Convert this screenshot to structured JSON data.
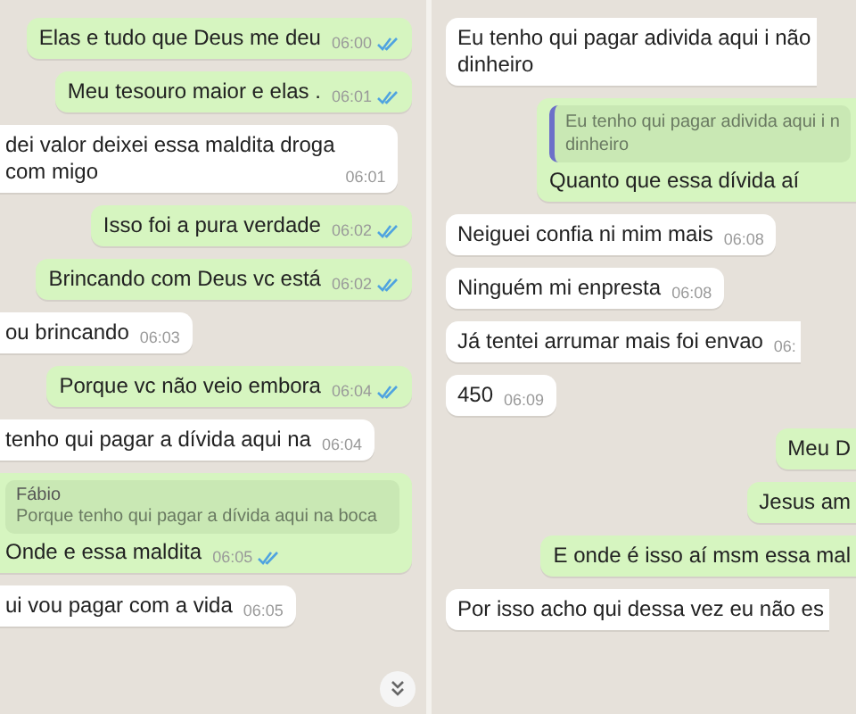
{
  "panels": [
    {
      "messages": [
        {
          "kind": "out",
          "text": "Elas e tudo que Deus me deu",
          "time": "06:00",
          "read": true
        },
        {
          "kind": "out",
          "text": "Meu tesouro maior e elas .",
          "time": "06:01",
          "read": true
        },
        {
          "kind": "in",
          "text": "dei valor deixei essa maldita droga\ncom migo",
          "time": "06:01",
          "cut_left": true
        },
        {
          "kind": "out",
          "text": "Isso foi a pura verdade",
          "time": "06:02",
          "read": true
        },
        {
          "kind": "out",
          "text": "Brincando com Deus vc está",
          "time": "06:02",
          "read": true
        },
        {
          "kind": "in",
          "text": "ou brincando",
          "time": "06:03",
          "cut_left": true
        },
        {
          "kind": "out",
          "text": "Porque vc não veio embora",
          "time": "06:04",
          "read": true
        },
        {
          "kind": "in",
          "text": "tenho qui pagar a dívida aqui na",
          "time": "06:04",
          "cut_left": true
        },
        {
          "kind": "out",
          "text": "Onde e essa maldita",
          "time": "06:05",
          "read": true,
          "cut_left": true,
          "quote": {
            "author": "Fábio",
            "text": "Porque tenho qui pagar a dívida aqui na boca"
          }
        },
        {
          "kind": "in",
          "text": "ui vou pagar com a vida",
          "time": "06:05",
          "cut_left": true
        }
      ],
      "scroll_button": true
    },
    {
      "messages": [
        {
          "kind": "in",
          "text": "Eu tenho qui pagar adivida aqui i não\ndinheiro",
          "cut_right": true
        },
        {
          "kind": "out",
          "text": "Quanto que essa dívida aí",
          "cut_right": true,
          "quote": {
            "text": "Eu tenho qui pagar adivida aqui i n\ndinheiro"
          }
        },
        {
          "kind": "in",
          "text": "Neiguei confia ni mim mais",
          "time": "06:08"
        },
        {
          "kind": "in",
          "text": "Ninguém mi enpresta",
          "time": "06:08"
        },
        {
          "kind": "in",
          "text": "Já tentei arrumar mais foi envao",
          "time": "06:",
          "cut_right": true
        },
        {
          "kind": "in",
          "text": "450",
          "time": "06:09"
        },
        {
          "kind": "out",
          "text": "Meu D",
          "cut_right": true
        },
        {
          "kind": "out",
          "text": "Jesus am",
          "cut_right": true
        },
        {
          "kind": "out",
          "text": "E onde é isso aí msm essa mal",
          "cut_right": true
        },
        {
          "kind": "in",
          "text": "Por isso acho qui dessa vez eu não es",
          "cut_right": true
        }
      ],
      "scroll_button": false
    }
  ]
}
